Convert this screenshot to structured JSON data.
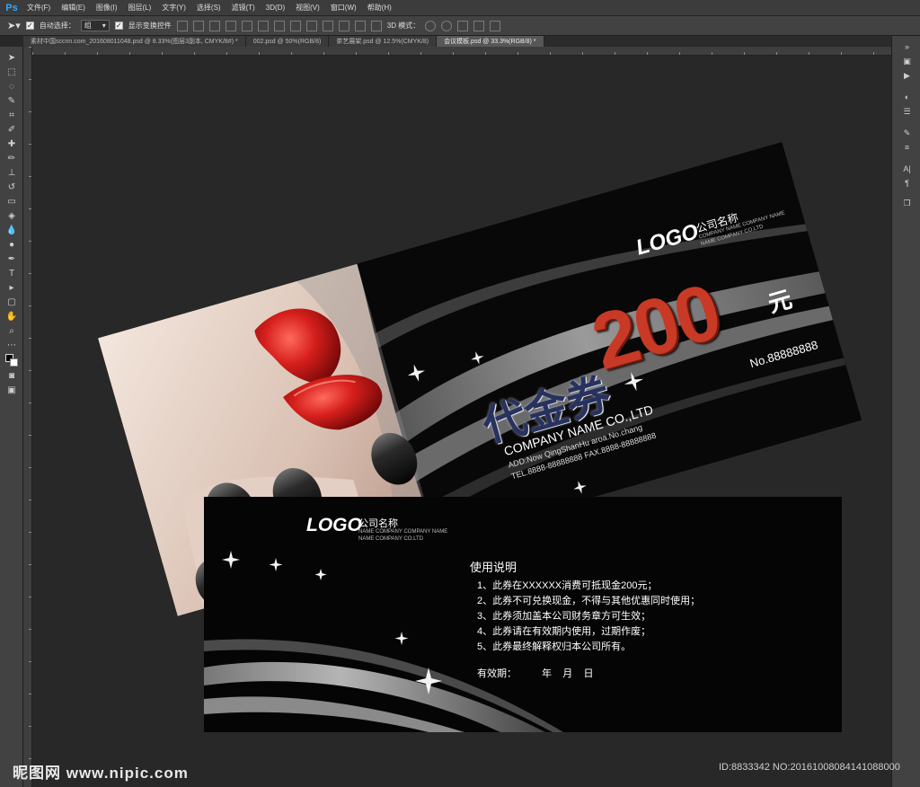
{
  "app": {
    "logo": "Ps"
  },
  "menu": [
    "文件(F)",
    "编辑(E)",
    "图像(I)",
    "图层(L)",
    "文字(Y)",
    "选择(S)",
    "滤镜(T)",
    "3D(D)",
    "视图(V)",
    "窗口(W)",
    "帮助(H)"
  ],
  "options": {
    "auto_select_label": "自动选择：",
    "auto_select_value": "组",
    "show_transform_label": "显示变换控件",
    "mode_3d_label": "3D 模式："
  },
  "tabs": [
    {
      "label": "素材中国sccnn.com_201608011048.psd @ 8.33%(图层3副本, CMYK/8#) *",
      "active": false
    },
    {
      "label": "002.psd @ 50%(RGB/8)",
      "active": false
    },
    {
      "label": "茶艺展架.psd @ 12.5%(CMYK/8)",
      "active": false
    },
    {
      "label": "会议模板.psd @ 33.3%(RGB/8) *",
      "active": true
    }
  ],
  "front": {
    "logo": "LOGO",
    "company_cn": "公司名称",
    "company_en_1": "COMPANY NAME COMPANY NAME",
    "company_en_2": "NAME COMPANY CO.LTD",
    "amount": "200",
    "yuan": "元",
    "title": "代金券",
    "number": "No.88888888",
    "company_name": "COMPANY NAME CO.,LTD",
    "address": "ADD:Now QingShanHu aroa.No.chang",
    "tel": "TEL.8888-88888888  FAX.8888-88888888"
  },
  "back": {
    "logo": "LOGO",
    "company_cn": "公司名称",
    "company_en_1": "NAME COMPANY COMPANY NAME",
    "company_en_2": "NAME COMPANY CO.LTD",
    "instructions_title": "使用说明",
    "rules": [
      "1、此券在XXXXXX消费可抵现金200元；",
      "2、此券不可兑换现金，不得与其他优惠同时使用；",
      "3、此券须加盖本公司财务章方可生效；",
      "4、此券请在有效期内使用，过期作废；",
      "5、此券最终解释权归本公司所有。"
    ],
    "validity_label": "有效期：",
    "validity_units": "年    月    日"
  },
  "footer": {
    "watermark": "昵图网 www.nipic.com",
    "image_id": "ID:8833342 NO:20161008084141088000"
  },
  "colors": {
    "accent_red": "#c83a26",
    "navy": "#27325e",
    "ps_blue": "#31a8ff"
  }
}
